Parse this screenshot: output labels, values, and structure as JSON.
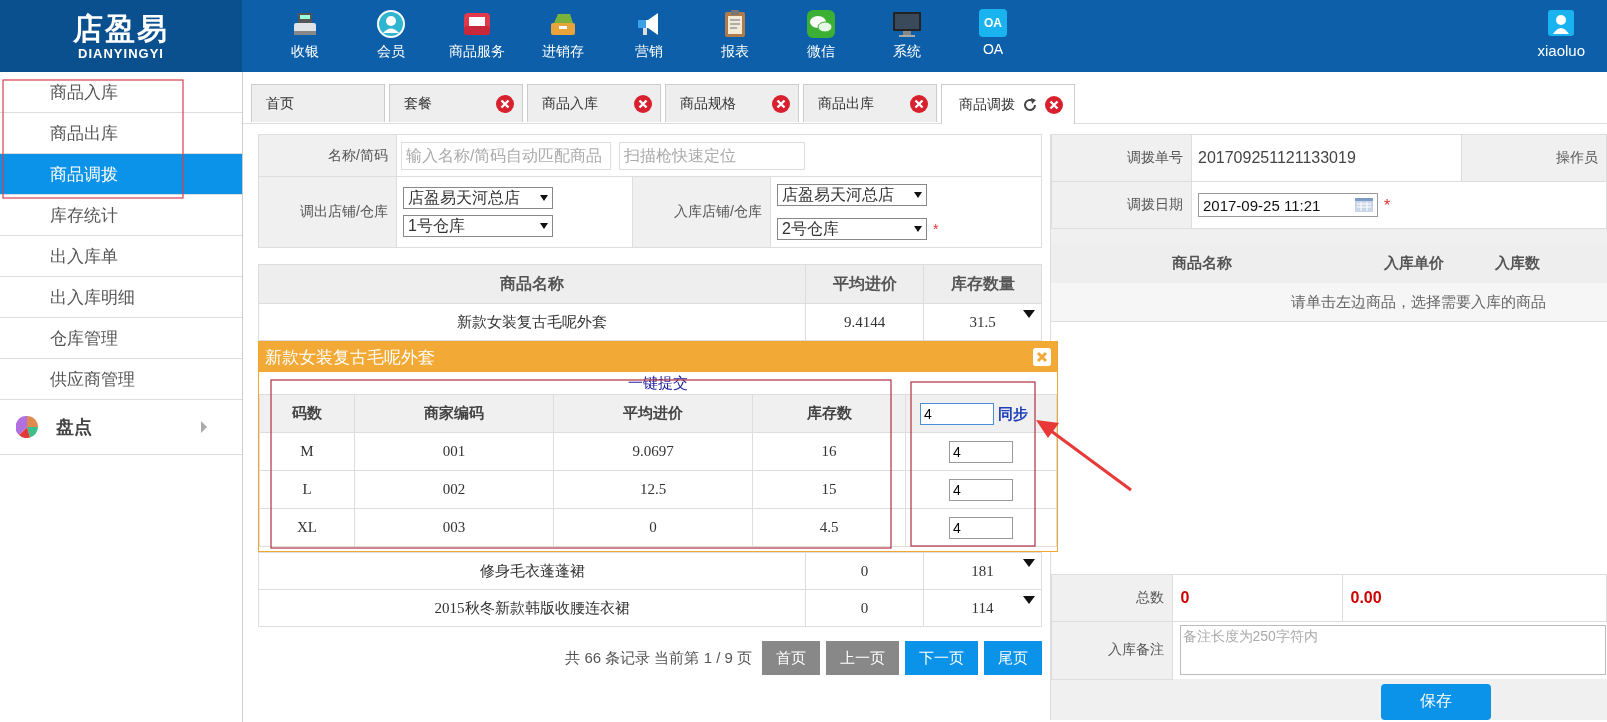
{
  "logo": {
    "name": "店盈易",
    "latin": "DIANYINGYI"
  },
  "nav": [
    {
      "label": "收银"
    },
    {
      "label": "会员"
    },
    {
      "label": "商品服务"
    },
    {
      "label": "进销存"
    },
    {
      "label": "营销"
    },
    {
      "label": "报表"
    },
    {
      "label": "微信"
    },
    {
      "label": "系统"
    },
    {
      "label": "OA",
      "icon_text": "OA"
    }
  ],
  "user": {
    "name": "xiaoluo"
  },
  "sidebar": {
    "items": [
      {
        "label": "商品入库",
        "selected": false
      },
      {
        "label": "商品出库",
        "selected": false
      },
      {
        "label": "商品调拨",
        "selected": true
      },
      {
        "label": "库存统计",
        "selected": false
      },
      {
        "label": "出入库单",
        "selected": false
      },
      {
        "label": "出入库明细",
        "selected": false
      },
      {
        "label": "仓库管理",
        "selected": false
      },
      {
        "label": "供应商管理",
        "selected": false
      }
    ],
    "group": {
      "label": "盘点",
      "expanded": false
    }
  },
  "tabs": [
    {
      "label": "首页",
      "selected": false,
      "closable": false
    },
    {
      "label": "套餐",
      "selected": false,
      "closable": true
    },
    {
      "label": "商品入库",
      "selected": false,
      "closable": true
    },
    {
      "label": "商品规格",
      "selected": false,
      "closable": true
    },
    {
      "label": "商品出库",
      "selected": false,
      "closable": true
    },
    {
      "label": "商品调拨",
      "selected": true,
      "closable": true
    }
  ],
  "filter": {
    "name_label": "名称/简码",
    "name_placeholder": "输入名称/简码自动匹配商品",
    "scan_placeholder": "扫描枪快速定位",
    "out_label": "调出店铺/仓库",
    "out_store": "店盈易天河总店",
    "out_warehouse": "1号仓库",
    "in_label": "入库店铺/仓库",
    "in_store": "店盈易天河总店",
    "in_warehouse": "2号仓库",
    "required_mark": "*"
  },
  "products": {
    "columns": [
      "商品名称",
      "平均进价",
      "库存数量"
    ],
    "rows_before": [
      {
        "name": "新款女装复古毛呢外套",
        "price": "9.4144",
        "stock": "31.5"
      }
    ],
    "rows_after": [
      {
        "name": "修身毛衣蓬蓬裙",
        "price": "0",
        "stock": "181"
      },
      {
        "name": "2015秋冬新款韩版收腰连衣裙",
        "price": "0",
        "stock": "114"
      }
    ]
  },
  "popup": {
    "title": "新款女装复古毛呢外套",
    "submit": "一键提交",
    "columns": [
      "码数",
      "商家编码",
      "平均进价",
      "库存数"
    ],
    "sync_value": "4",
    "sync_label": "同步",
    "rows": [
      {
        "size": "M",
        "code": "001",
        "price": "9.0697",
        "stock": "16",
        "qty": "4"
      },
      {
        "size": "L",
        "code": "002",
        "price": "12.5",
        "stock": "15",
        "qty": "4"
      },
      {
        "size": "XL",
        "code": "003",
        "price": "0",
        "stock": "4.5",
        "qty": "4"
      }
    ]
  },
  "pager": {
    "summary": "共 66 条记录 当前第 1 / 9 页",
    "buttons": [
      {
        "label": "首页",
        "disabled": true
      },
      {
        "label": "上一页",
        "disabled": true
      },
      {
        "label": "下一页",
        "disabled": false
      },
      {
        "label": "尾页",
        "disabled": false
      }
    ]
  },
  "order": {
    "order_label": "调拨单号",
    "order_no": "201709251121133019",
    "operator_label": "操作员",
    "date_label": "调拨日期",
    "date": "2017-09-25 11:21",
    "required_mark": "*",
    "columns": [
      "商品名称",
      "入库单价",
      "入库数"
    ],
    "empty_hint": "请单击左边商品，选择需要入库的商品",
    "total_label": "总数",
    "total_qty": "0",
    "total_amount": "0.00",
    "remark_label": "入库备注",
    "remark_placeholder": "备注长度为250字符内",
    "save": "保存"
  }
}
